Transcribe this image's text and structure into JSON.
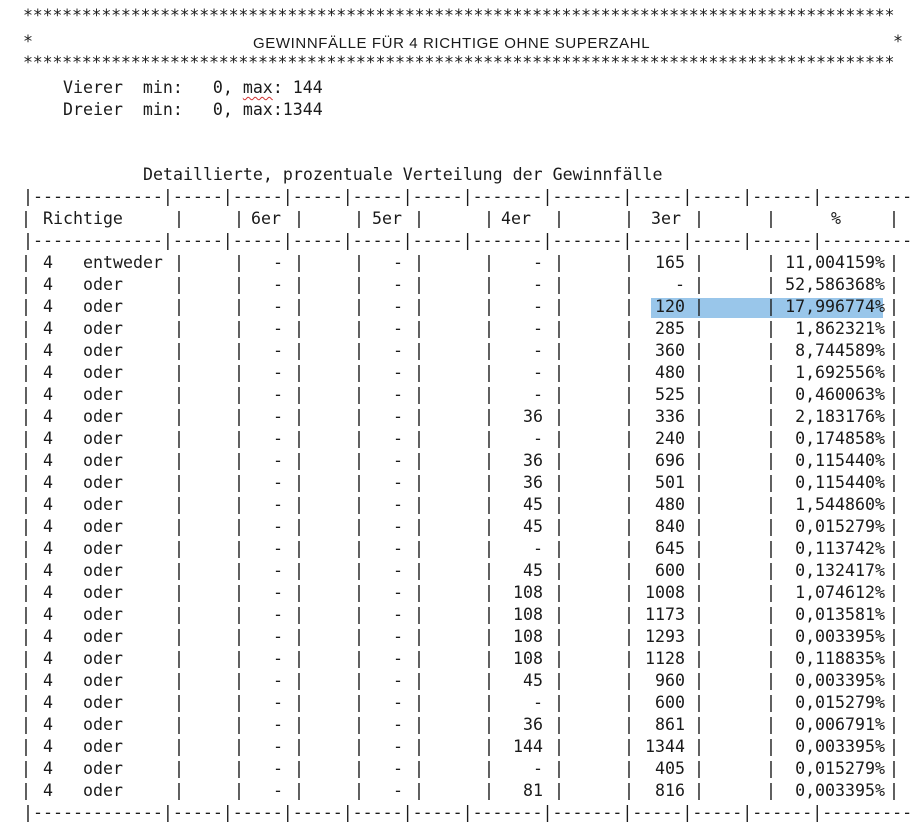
{
  "header": {
    "stars_top": "*****************************************************************************************",
    "title": "GEWINNFÄLLE FÜR 4 RICHTIGE OHNE SUPERZAHL",
    "star_left": "*",
    "star_right": "*",
    "stars_bottom": "*****************************************************************************************"
  },
  "summary": [
    {
      "label": "Vierer",
      "min_label": "min:",
      "min": "0,",
      "max_label": "max",
      "max": ": 144"
    },
    {
      "label": "Dreier",
      "min_label": "min:",
      "min": "0,",
      "max_label": "max",
      "max": ":1344"
    }
  ],
  "table": {
    "caption": "Detaillierte, prozentuale Verteilung der Gewinnfälle",
    "rule": "|-------------|-----|-----|-----|-----|-----|-------|-------|-----|-----|------|-----------|",
    "headers": {
      "richtige": "Richtige",
      "c6": "6er",
      "c5": "5er",
      "c4": "4er",
      "c3": "3er",
      "pct": "%"
    },
    "selected_row": 2,
    "rows": [
      {
        "n": "4",
        "word": "entweder",
        "c6": "-",
        "c5": "-",
        "c4": "-",
        "c3": "165",
        "pct": "11,004159%"
      },
      {
        "n": "4",
        "word": "oder",
        "c6": "-",
        "c5": "-",
        "c4": "-",
        "c3": "-",
        "pct": "52,586368%"
      },
      {
        "n": "4",
        "word": "oder",
        "c6": "-",
        "c5": "-",
        "c4": "-",
        "c3": "120",
        "pct": "17,996774%"
      },
      {
        "n": "4",
        "word": "oder",
        "c6": "-",
        "c5": "-",
        "c4": "-",
        "c3": "285",
        "pct": "1,862321%"
      },
      {
        "n": "4",
        "word": "oder",
        "c6": "-",
        "c5": "-",
        "c4": "-",
        "c3": "360",
        "pct": "8,744589%"
      },
      {
        "n": "4",
        "word": "oder",
        "c6": "-",
        "c5": "-",
        "c4": "-",
        "c3": "480",
        "pct": "1,692556%"
      },
      {
        "n": "4",
        "word": "oder",
        "c6": "-",
        "c5": "-",
        "c4": "-",
        "c3": "525",
        "pct": "0,460063%"
      },
      {
        "n": "4",
        "word": "oder",
        "c6": "-",
        "c5": "-",
        "c4": "36",
        "c3": "336",
        "pct": "2,183176%"
      },
      {
        "n": "4",
        "word": "oder",
        "c6": "-",
        "c5": "-",
        "c4": "-",
        "c3": "240",
        "pct": "0,174858%"
      },
      {
        "n": "4",
        "word": "oder",
        "c6": "-",
        "c5": "-",
        "c4": "36",
        "c3": "696",
        "pct": "0,115440%"
      },
      {
        "n": "4",
        "word": "oder",
        "c6": "-",
        "c5": "-",
        "c4": "36",
        "c3": "501",
        "pct": "0,115440%"
      },
      {
        "n": "4",
        "word": "oder",
        "c6": "-",
        "c5": "-",
        "c4": "45",
        "c3": "480",
        "pct": "1,544860%"
      },
      {
        "n": "4",
        "word": "oder",
        "c6": "-",
        "c5": "-",
        "c4": "45",
        "c3": "840",
        "pct": "0,015279%"
      },
      {
        "n": "4",
        "word": "oder",
        "c6": "-",
        "c5": "-",
        "c4": "-",
        "c3": "645",
        "pct": "0,113742%"
      },
      {
        "n": "4",
        "word": "oder",
        "c6": "-",
        "c5": "-",
        "c4": "45",
        "c3": "600",
        "pct": "0,132417%"
      },
      {
        "n": "4",
        "word": "oder",
        "c6": "-",
        "c5": "-",
        "c4": "108",
        "c3": "1008",
        "pct": "1,074612%"
      },
      {
        "n": "4",
        "word": "oder",
        "c6": "-",
        "c5": "-",
        "c4": "108",
        "c3": "1173",
        "pct": "0,013581%"
      },
      {
        "n": "4",
        "word": "oder",
        "c6": "-",
        "c5": "-",
        "c4": "108",
        "c3": "1293",
        "pct": "0,003395%"
      },
      {
        "n": "4",
        "word": "oder",
        "c6": "-",
        "c5": "-",
        "c4": "108",
        "c3": "1128",
        "pct": "0,118835%"
      },
      {
        "n": "4",
        "word": "oder",
        "c6": "-",
        "c5": "-",
        "c4": "45",
        "c3": "960",
        "pct": "0,003395%"
      },
      {
        "n": "4",
        "word": "oder",
        "c6": "-",
        "c5": "-",
        "c4": "-",
        "c3": "600",
        "pct": "0,015279%"
      },
      {
        "n": "4",
        "word": "oder",
        "c6": "-",
        "c5": "-",
        "c4": "36",
        "c3": "861",
        "pct": "0,006791%"
      },
      {
        "n": "4",
        "word": "oder",
        "c6": "-",
        "c5": "-",
        "c4": "144",
        "c3": "1344",
        "pct": "0,003395%"
      },
      {
        "n": "4",
        "word": "oder",
        "c6": "-",
        "c5": "-",
        "c4": "-",
        "c3": "405",
        "pct": "0,015279%"
      },
      {
        "n": "4",
        "word": "oder",
        "c6": "-",
        "c5": "-",
        "c4": "81",
        "c3": "816",
        "pct": "0,003395%"
      }
    ]
  }
}
